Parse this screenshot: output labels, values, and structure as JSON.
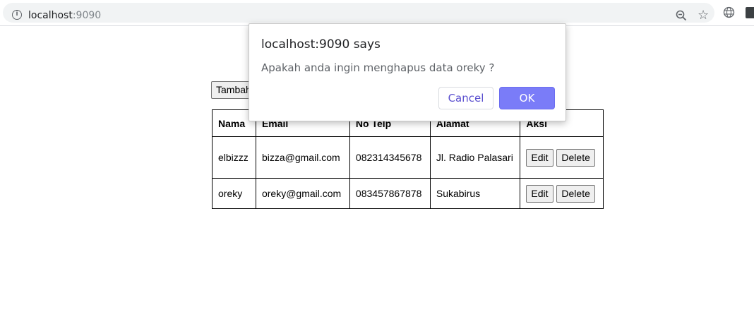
{
  "browser": {
    "url_host": "localhost",
    "url_port": ":9090",
    "icons": [
      "info-icon",
      "zoom-icon",
      "star-icon",
      "globe-icon",
      "extension-icon"
    ]
  },
  "page": {
    "add_button_label": "Tambah Data",
    "table": {
      "headers": [
        "Nama",
        "Email",
        "No Telp",
        "Alamat",
        "Aksi"
      ],
      "rows": [
        {
          "nama": "elbizzz",
          "email": "bizza@gmail.com",
          "telp": "082314345678",
          "alamat": "Jl. Radio Palasari",
          "edit": "Edit",
          "delete": "Delete"
        },
        {
          "nama": "oreky",
          "email": "oreky@gmail.com",
          "telp": "083457867878",
          "alamat": "Sukabirus",
          "edit": "Edit",
          "delete": "Delete"
        }
      ]
    }
  },
  "dialog": {
    "title": "localhost:9090 says",
    "message": "Apakah anda ingin menghapus data oreky ?",
    "cancel_label": "Cancel",
    "ok_label": "OK",
    "accent_color": "#7a7cf8"
  }
}
